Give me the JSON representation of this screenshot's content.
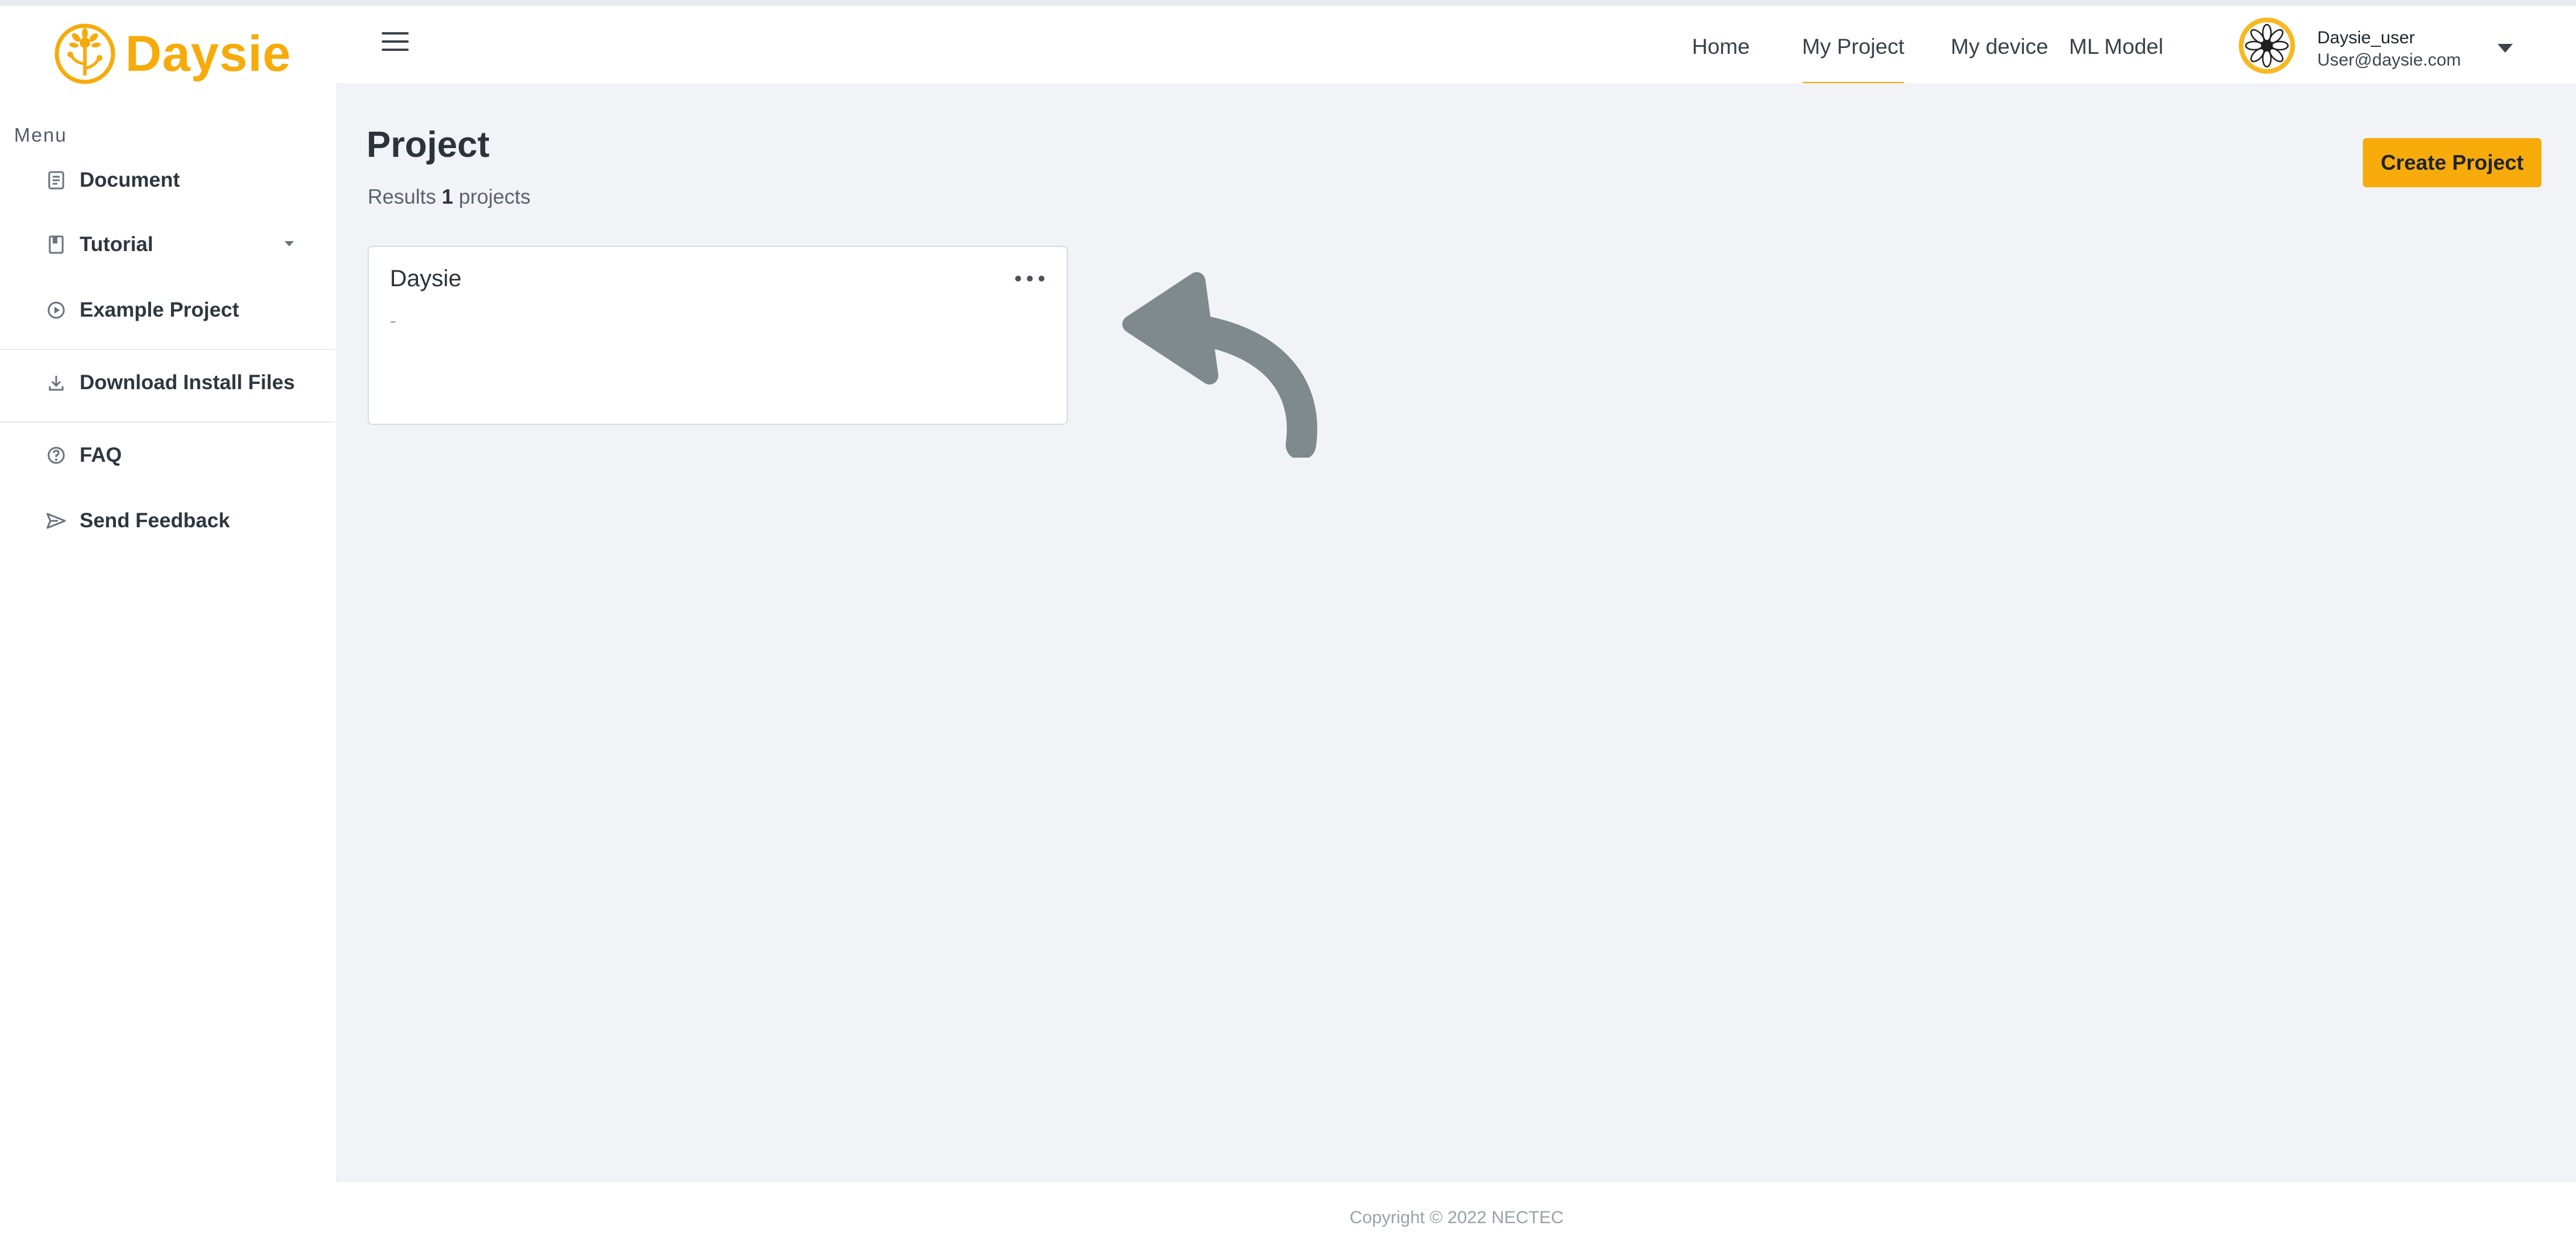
{
  "app": {
    "brand": "Daysie"
  },
  "sidebar": {
    "menu_caption": "Menu",
    "items": [
      {
        "label": "Document",
        "icon": "document-icon"
      },
      {
        "label": "Tutorial",
        "icon": "book-icon",
        "has_submenu": true
      },
      {
        "label": "Example Project",
        "icon": "play-circle-icon"
      },
      {
        "label": "Download Install Files",
        "icon": "download-icon"
      },
      {
        "label": "FAQ",
        "icon": "question-circle-icon"
      },
      {
        "label": "Send Feedback",
        "icon": "send-icon"
      }
    ]
  },
  "header": {
    "nav": [
      {
        "label": "Home",
        "active": false
      },
      {
        "label": "My Project",
        "active": true
      },
      {
        "label": "My device",
        "active": false
      },
      {
        "label": "ML Model",
        "active": false
      }
    ],
    "user": {
      "name": "Daysie_user",
      "email": "User@daysie.com"
    }
  },
  "main": {
    "title": "Project",
    "results_prefix": "Results",
    "results_count": "1",
    "results_suffix": "projects",
    "create_button": "Create Project",
    "projects": [
      {
        "name": "Daysie",
        "description": "-"
      }
    ]
  },
  "footer": {
    "copyright": "Copyright © 2022 NECTEC"
  },
  "colors": {
    "accent": "#f7ab0a",
    "main_bg": "#f2f3f7",
    "arrow": "#7f8a8c"
  }
}
